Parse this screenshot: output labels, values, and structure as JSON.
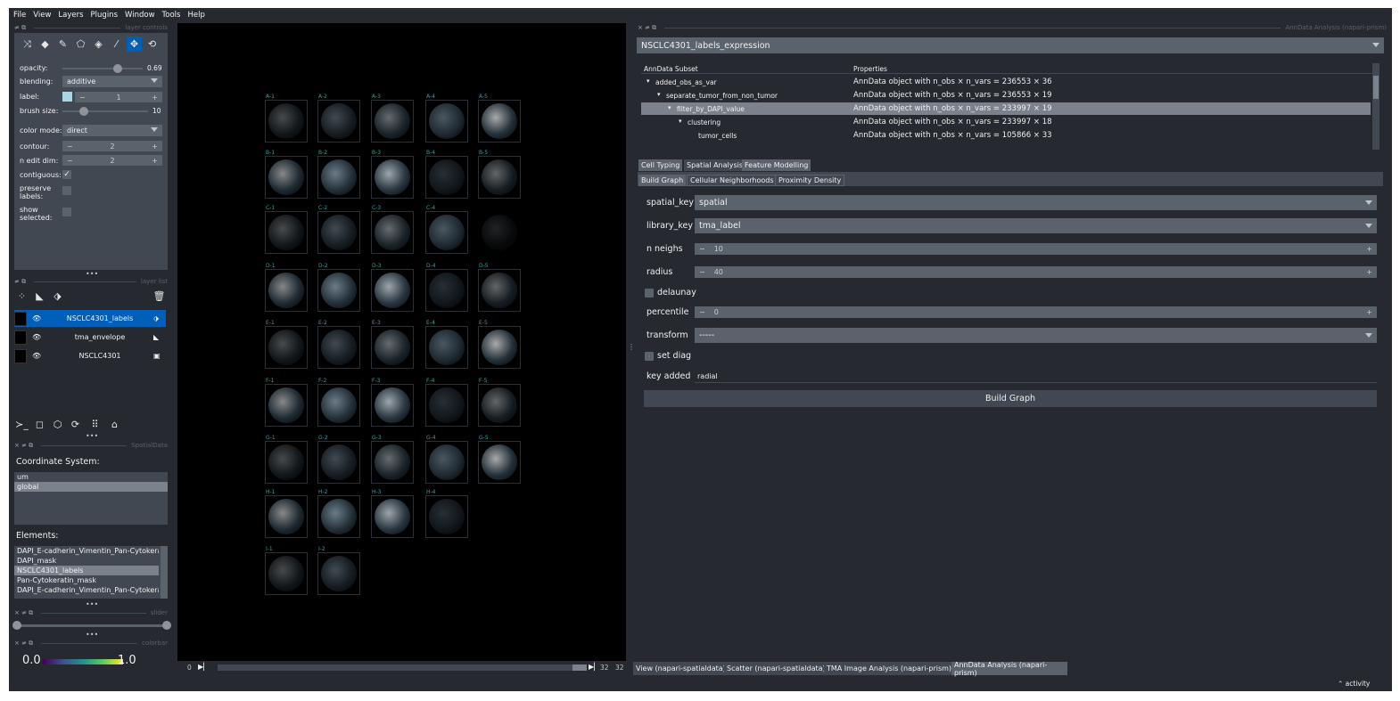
{
  "menu": [
    "File",
    "View",
    "Layers",
    "Plugins",
    "Window",
    "Tools",
    "Help"
  ],
  "layer_controls": {
    "title": "layer controls",
    "opacity_label": "opacity:",
    "opacity": 0.69,
    "opacity_text": "0.69",
    "blending_label": "blending:",
    "blending_value": "additive",
    "label_label": "label:",
    "label_value": "1",
    "brush_label": "brush size:",
    "brush_value": "10",
    "brush_fraction": 0.25,
    "color_mode_label": "color mode:",
    "color_mode_value": "direct",
    "contour_label": "contour:",
    "contour_value": "2",
    "n_edit_label": "n edit dim:",
    "n_edit_value": "2",
    "contiguous_label": "contiguous:",
    "preserve_label": "preserve labels:",
    "show_label": "show selected:",
    "minus": "−",
    "plus": "+"
  },
  "layer_list": {
    "title": "layer list",
    "layers": [
      {
        "name": "NSCLC4301_labels",
        "selected": true
      },
      {
        "name": "tma_envelope",
        "selected": false
      },
      {
        "name": "NSCLC4301",
        "selected": false
      }
    ]
  },
  "spatialdata": {
    "title": "SpatialData",
    "coord_label": "Coordinate System:",
    "coords": [
      "um",
      "global"
    ],
    "selected_coord": "global",
    "elements_label": "Elements:",
    "elements": [
      "DAPI_E-cadherin_Vimentin_Pan-Cytokerati",
      "DAPI_mask",
      "NSCLC4301_labels",
      "Pan-Cytokeratin_mask",
      "DAPI_E-cadherin_Vimentin_Pan-Cytokerati"
    ],
    "selected_element": "NSCLC4301_labels"
  },
  "slider_title": "slider",
  "colorbar": {
    "title": "colorbar",
    "min": "0.0",
    "max": "1.0"
  },
  "canvas": {
    "rows": [
      [
        "A-1",
        "A-2",
        "A-3",
        "A-4",
        "A-5"
      ],
      [
        "B-1",
        "B-2",
        "B-3",
        "B-4",
        "B-5"
      ],
      [
        "C-1",
        "C-2",
        "C-3",
        "C-4",
        ""
      ],
      [
        "D-1",
        "D-2",
        "D-3",
        "D-4",
        "D-5"
      ],
      [
        "E-1",
        "E-2",
        "E-3",
        "E-4",
        "E-5"
      ],
      [
        "F-1",
        "F-2",
        "F-3",
        "F-4",
        "F-5"
      ],
      [
        "G-1",
        "G-2",
        "G-3",
        "G-4",
        "G-5"
      ],
      [
        "H-1",
        "H-2",
        "H-3",
        "H-4"
      ],
      [
        "I-1",
        "I-2"
      ]
    ],
    "frame_current": "0",
    "frame_a": "32",
    "frame_b": "32"
  },
  "anndata": {
    "title": "AnnData Analysis (napari-prism)",
    "dataset": "NSCLC4301_labels_expression",
    "col_subset": "AnnData Subset",
    "col_props": "Properties",
    "tree": [
      {
        "name": "added_obs_as_var",
        "prop": "AnnData object with n_obs × n_vars = 236553 × 36",
        "indent": 0,
        "selected": false
      },
      {
        "name": "separate_tumor_from_non_tumor",
        "prop": "AnnData object with n_obs × n_vars = 236553 × 19",
        "indent": 1,
        "selected": false
      },
      {
        "name": "filter_by_DAPI_value",
        "prop": "AnnData object with n_obs × n_vars = 233997 × 19",
        "indent": 2,
        "selected": true
      },
      {
        "name": "clustering",
        "prop": "AnnData object with n_obs × n_vars = 233997 × 18",
        "indent": 3,
        "selected": false
      },
      {
        "name": "tumor_cells",
        "prop": "AnnData object with n_obs × n_vars = 105866 × 33",
        "indent": 4,
        "selected": false
      }
    ],
    "tabs": [
      "Cell Typing",
      "Spatial Analysis",
      "Feature Modelling"
    ],
    "active_tab": "Spatial Analysis",
    "subtabs": [
      "Build Graph",
      "Cellular Neighborhoods",
      "Proximity Density"
    ],
    "active_subtab": "Build Graph",
    "form": {
      "spatial_key_label": "spatial_key",
      "spatial_key": "spatial",
      "library_key_label": "library_key",
      "library_key": "tma_label",
      "n_neighs_label": "n neighs",
      "n_neighs": "10",
      "radius_label": "radius",
      "radius": "40",
      "delaunay_label": "delaunay",
      "percentile_label": "percentile",
      "percentile": "0",
      "transform_label": "transform",
      "transform": "-----",
      "set_diag_label": "set diag",
      "key_added_label": "key added",
      "key_added": "radial",
      "build_button": "Build Graph"
    }
  },
  "bottom_tabs": [
    "View (napari-spatialdata)",
    "Scatter (napari-spatialdata)",
    "TMA Image Analysis (napari-prism)",
    "AnnData Analysis (napari-prism)"
  ],
  "active_bottom_tab": "AnnData Analysis (napari-prism)",
  "status": "activity",
  "colors": {
    "accent": "#005fb8",
    "bg": "#262930",
    "panel": "#414851",
    "field": "#5a626c"
  }
}
